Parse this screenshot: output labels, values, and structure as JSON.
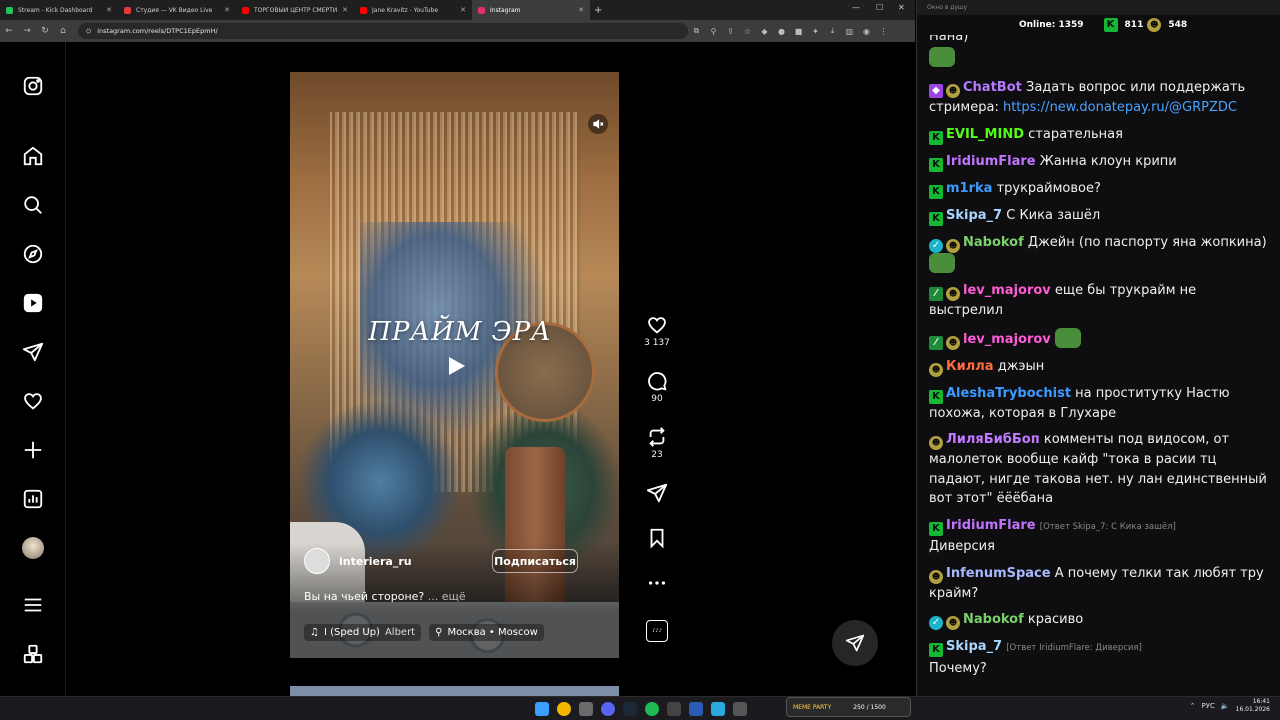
{
  "browser": {
    "tabs": [
      {
        "title": "Stream - Kick Dashboard",
        "color": "#22c55e"
      },
      {
        "title": "Студия — VK Видео Live",
        "color": "#e53935"
      },
      {
        "title": "ТОРГОВЫЙ ЦЕНТР СМЕРТИ -",
        "color": "#ff0000"
      },
      {
        "title": "Jane Kravitz - YouTube",
        "color": "#ff0000"
      },
      {
        "title": "Instagram",
        "color": "#e1306c",
        "active": true
      }
    ],
    "url": "instagram.com/reels/DTPC1EpEpmH/"
  },
  "reel": {
    "overlay_title": "ПРАЙМ ЭРА",
    "username": "interiera_ru",
    "follow_label": "Подписаться",
    "caption": "Вы на чьей стороне?",
    "more_label": "... ещё",
    "music": "I (Sped Up)",
    "artist": "Albert",
    "location": "Москва • Moscow",
    "likes": "3 137",
    "comments": "90",
    "reposts": "23"
  },
  "chat": {
    "window_title": "Окно в душу",
    "online_label": "Online:",
    "online_count": "1359",
    "kick_count": "811",
    "vk_count": "548",
    "top_fragment": "Нана)",
    "messages": [
      {
        "badges": [
          "bot",
          "pepe"
        ],
        "nick": "ChatBot",
        "color": "#b57bff",
        "text": "Задать вопрос или поддержать стримера:",
        "link": "https://new.donatepay.ru/@GRPZDC"
      },
      {
        "badges": [
          "kb"
        ],
        "nick": "EVIL_MIND",
        "color": "#53fc18",
        "text": "старательная"
      },
      {
        "badges": [
          "kb"
        ],
        "nick": "IridiumFlare",
        "color": "#c074ff",
        "text": "Жанна клоун крипи"
      },
      {
        "badges": [
          "kb"
        ],
        "nick": "m1rka",
        "color": "#3d9bff",
        "text": "трукраймовое?"
      },
      {
        "badges": [
          "kb"
        ],
        "nick": "Skipa_7",
        "color": "#a9d6ff",
        "text": "С Кика зашёл"
      },
      {
        "badges": [
          "ver",
          "pepe"
        ],
        "nick": "Nabokof",
        "color": "#7bd06b",
        "text": "Джейн (по паспорту яна жопкина)"
      },
      {
        "badges": [
          "mod",
          "pepe"
        ],
        "nick": "lev_majorov",
        "color": "#ff5bd6",
        "text": "еще бы трукрайм не выстрелил"
      },
      {
        "badges": [
          "mod",
          "pepe"
        ],
        "nick": "lev_majorov",
        "color": "#ff5bd6",
        "text": ""
      },
      {
        "badges": [
          "pepe"
        ],
        "nick": "Килла",
        "color": "#ff6b3d",
        "text": "джэын"
      },
      {
        "badges": [
          "kb"
        ],
        "nick": "AleshaTrybochist",
        "color": "#3d9bff",
        "text": "на проститутку Настю похожа, которая в Глухаре"
      },
      {
        "badges": [
          "pepe"
        ],
        "nick": "ЛиляБибБоп",
        "color": "#c27bff",
        "text": "комменты под видосом, от малолеток вообще кайф \"тока в расии тц падают, нигде такова нет. ну лан единственный вот этот\" ёёёбана"
      },
      {
        "badges": [
          "kb"
        ],
        "nick": "IridiumFlare",
        "color": "#c074ff",
        "reply": "[Ответ Skipa_7: С Кика зашёл]",
        "text": "Диверсия"
      },
      {
        "badges": [
          "pepe"
        ],
        "nick": "InfenumSpace",
        "color": "#a8b8ff",
        "text": "А почему телки так любят тру крайм?"
      },
      {
        "badges": [
          "ver",
          "pepe"
        ],
        "nick": "Nabokof",
        "color": "#7bd06b",
        "text": "красиво"
      },
      {
        "badges": [
          "kb"
        ],
        "nick": "Skipa_7",
        "color": "#a9d6ff",
        "reply": "[Ответ IridiumFlare: Диверсия]",
        "text": "Почему?"
      }
    ]
  },
  "taskbar": {
    "meme_label": "MEME PARTY",
    "meme_counter": "250 / 1500",
    "lang": "РУС",
    "time": "16:41",
    "date": "16.01.2026"
  }
}
